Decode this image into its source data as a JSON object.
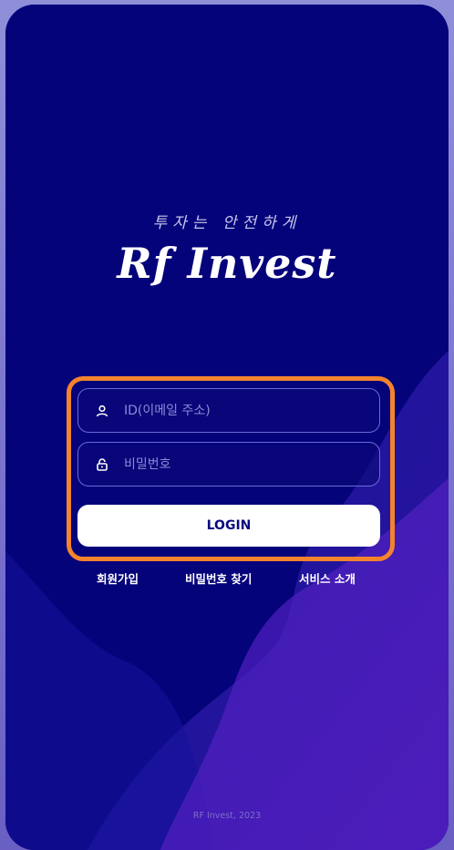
{
  "header": {
    "tagline": "투자는 안전하게",
    "logo_text": "Rf Invest"
  },
  "form": {
    "id_placeholder": "ID(이메일 주소)",
    "password_placeholder": "비밀번호",
    "login_label": "LOGIN"
  },
  "links": {
    "signup": "회원가입",
    "find_password": "비밀번호 찾기",
    "service_intro": "서비스 소개"
  },
  "footer": {
    "copyright": "RF Invest, 2023"
  },
  "icons": {
    "id_field": "user-icon",
    "password_field": "lock-icon"
  },
  "colors": {
    "background": "#05037a",
    "accent_frame": "#f4832d",
    "button_bg": "#ffffff",
    "button_text": "#0a0880"
  }
}
